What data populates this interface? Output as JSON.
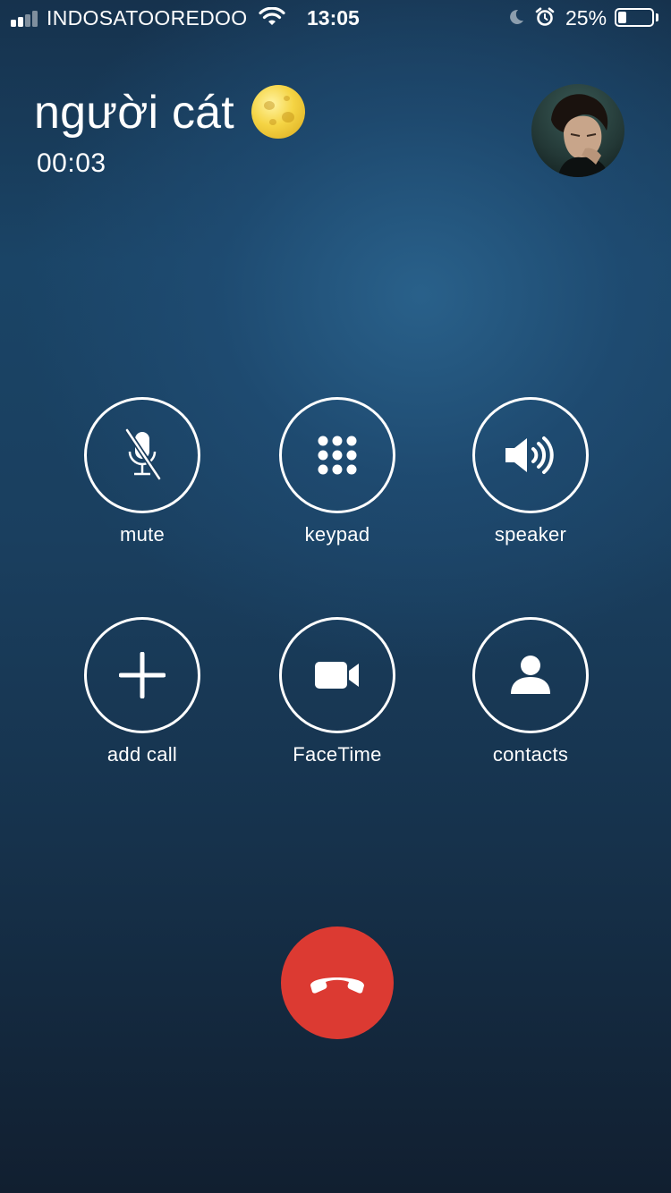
{
  "status_bar": {
    "carrier": "INDOSATOOREDOO",
    "time": "13:05",
    "battery_percent": "25%",
    "battery_level": 0.25,
    "signal_bars": 2,
    "icons": [
      "signal-icon",
      "wifi-icon",
      "do-not-disturb-moon-icon",
      "alarm-icon",
      "battery-icon"
    ]
  },
  "call": {
    "caller_name": "người cát",
    "caller_emoji": "full-moon-emoji",
    "duration": "00:03"
  },
  "controls": {
    "mute": {
      "label": "mute",
      "icon": "mic-muted-icon"
    },
    "keypad": {
      "label": "keypad",
      "icon": "keypad-grid-icon"
    },
    "speaker": {
      "label": "speaker",
      "icon": "speaker-icon"
    },
    "add_call": {
      "label": "add call",
      "icon": "plus-icon"
    },
    "facetime": {
      "label": "FaceTime",
      "icon": "video-camera-icon"
    },
    "contacts": {
      "label": "contacts",
      "icon": "person-icon"
    }
  },
  "end_call": {
    "icon": "hang-up-icon",
    "color": "#dc3a32"
  }
}
